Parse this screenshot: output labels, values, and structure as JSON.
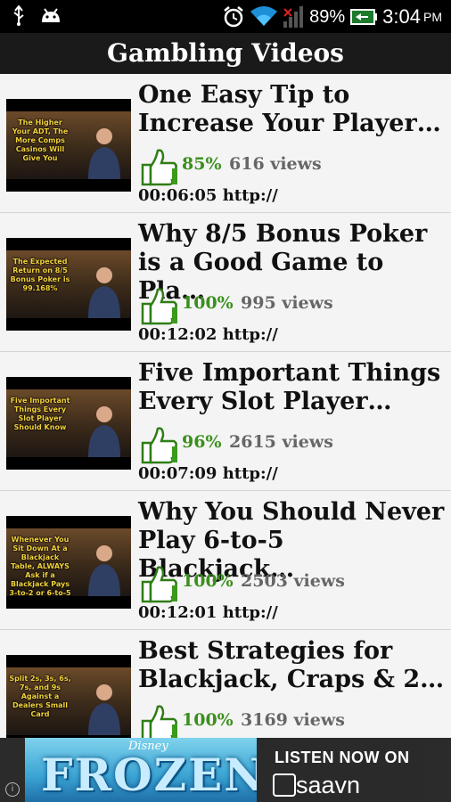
{
  "status_bar": {
    "battery_percent": "89%",
    "time": "3:04",
    "ampm": "PM",
    "icons": [
      "usb-icon",
      "android-icon",
      "alarm-icon",
      "wifi-icon",
      "signal-icon",
      "battery-icon"
    ]
  },
  "app_bar": {
    "title": "Gambling Videos"
  },
  "videos": [
    {
      "title": "One Easy Tip to\nIncrease Your Player…",
      "rating": "85%",
      "views": "616 views",
      "duration": "00:06:05",
      "link": "http://",
      "thumbnail_caption": "The Higher Your ADT, The More Comps Casinos Will Give You"
    },
    {
      "title": "Why 8/5 Bonus Poker\nis a Good Game to Pla…",
      "rating": "100%",
      "views": "995 views",
      "duration": "00:12:02",
      "link": "http://",
      "thumbnail_caption": "The Expected Return on 8/5 Bonus Poker is 99.168%"
    },
    {
      "title": "Five Important Things\nEvery Slot Player…",
      "rating": "96%",
      "views": "2615 views",
      "duration": "00:07:09",
      "link": "http://",
      "thumbnail_caption": "Five Important Things Every Slot Player Should Know"
    },
    {
      "title": "Why You Should Never\nPlay 6-to-5 Blackjack…",
      "rating": "100%",
      "views": "2503 views",
      "duration": "00:12:01",
      "link": "http://",
      "thumbnail_caption": "Whenever You Sit Down At a Blackjack Table, ALWAYS Ask if a Blackjack Pays 3-to-2 or 6-to-5"
    },
    {
      "title": "Best Strategies for\nBlackjack, Craps & 2…",
      "rating": "100%",
      "views": "3169 views",
      "duration": "",
      "link": "",
      "thumbnail_caption": "Split 2s, 3s, 6s, 7s, and 9s Against a Dealers Small Card"
    }
  ],
  "ad": {
    "left_brand": "Disney",
    "left_title": "FROZEN",
    "right_headline": "LISTEN NOW ON",
    "right_brand": "saavn",
    "info_glyph": "i"
  },
  "colors": {
    "rating_green": "#3a8f1c",
    "app_bar_bg": "#1a1a1a",
    "thumb_caption": "#f2d23a"
  }
}
